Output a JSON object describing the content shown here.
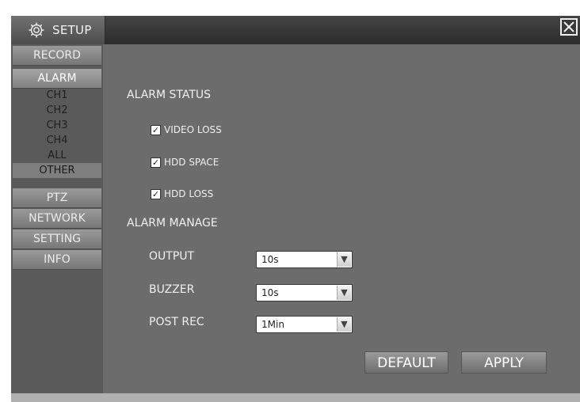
{
  "window": {
    "title": "SETUP",
    "title_icon": "gear-icon",
    "close_icon": "close-icon"
  },
  "sidebar": {
    "record": "RECORD",
    "alarm": "ALARM",
    "alarm_sub": [
      "CH1",
      "CH2",
      "CH3",
      "CH4",
      "ALL",
      "OTHER"
    ],
    "ptz": "PTZ",
    "network": "NETWORK",
    "setting": "SETTING",
    "info": "INFO"
  },
  "alarm_status": {
    "heading": "ALARM STATUS",
    "video_loss": {
      "label": "VIDEO LOSS",
      "checked": true
    },
    "hdd_space": {
      "label": "HDD SPACE",
      "checked": true
    },
    "hdd_loss": {
      "label": "HDD LOSS",
      "checked": true
    }
  },
  "alarm_manage": {
    "heading": "ALARM MANAGE",
    "output": {
      "label": "OUTPUT",
      "value": "10s"
    },
    "buzzer": {
      "label": "BUZZER",
      "value": "10s"
    },
    "post_rec": {
      "label": "POST REC",
      "value": "1Min"
    }
  },
  "buttons": {
    "default": "DEFAULT",
    "apply": "APPLY"
  },
  "colors": {
    "panel": "#6c6c6c",
    "sidebar": "#5a5a5a",
    "titlebar": "#2c2c2c"
  }
}
